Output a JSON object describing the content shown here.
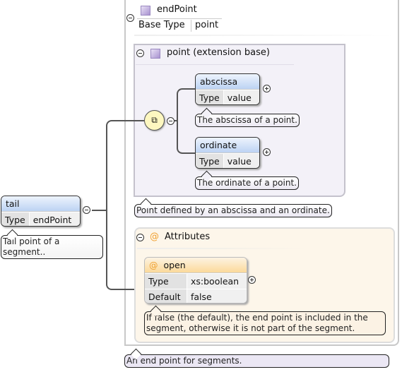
{
  "complex_type": {
    "name": "endPoint",
    "base_type_label": "Base Type",
    "base_type": "point",
    "documentation": "An end point for segments."
  },
  "extension": {
    "label": "point (extension base)",
    "documentation": "Point defined by an abscissa and an ordinate.",
    "elements": [
      {
        "name": "abscissa",
        "type_label": "Type",
        "type": "value",
        "documentation": "The abscissa of a point."
      },
      {
        "name": "ordinate",
        "type_label": "Type",
        "type": "value",
        "documentation": "The ordinate of a point."
      }
    ]
  },
  "attributes": {
    "label": "Attributes",
    "icon": "@",
    "items": [
      {
        "name": "open",
        "type_label": "Type",
        "type": "xs:boolean",
        "default_label": "Default",
        "default": "false",
        "documentation": "If false (the default), the end point is included in the segment, otherwise it is not part of the segment."
      }
    ]
  },
  "root": {
    "name": "tail",
    "type_label": "Type",
    "type": "endPoint",
    "documentation": "Tail point of a segment.."
  },
  "colors": {
    "element_header": "#bcd3f3",
    "attribute_header": "#fbd99a",
    "extension_bg": "#f3f1f8",
    "attributes_bg": "#fdf6ea",
    "compositor": "#fdf7c0"
  }
}
